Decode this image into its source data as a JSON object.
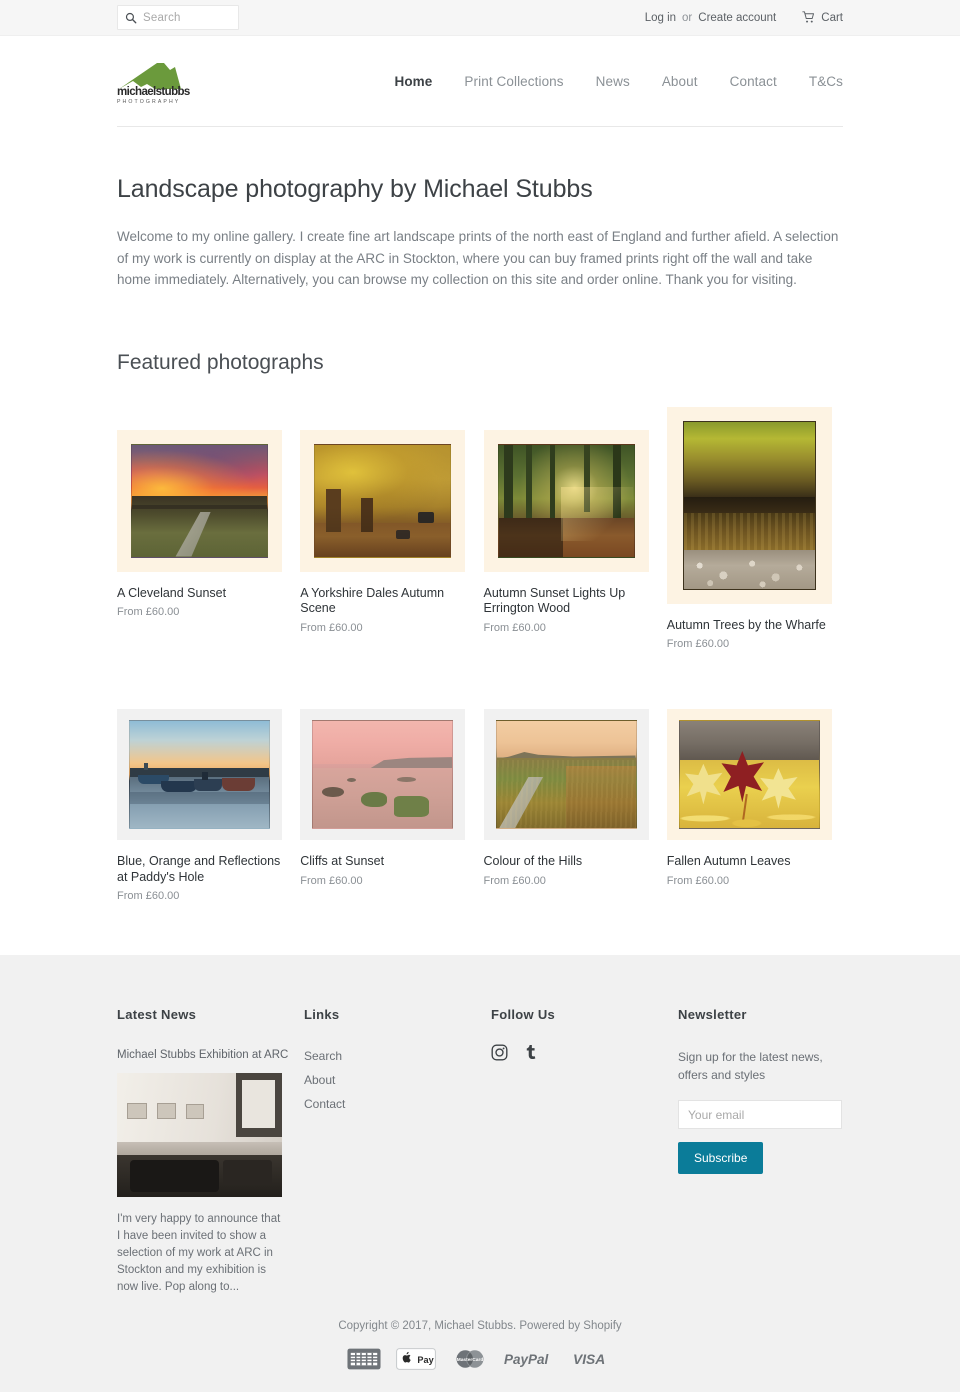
{
  "topbar": {
    "search": {
      "placeholder": "Search",
      "icon": "search-icon"
    },
    "login_label": "Log in",
    "or_label": "or",
    "create_account_label": "Create account",
    "cart_label": "Cart",
    "cart_icon": "cart-icon"
  },
  "header": {
    "logo_wordmark": "michaelstubbs",
    "logo_subtext": "PHOTOGRAPHY",
    "logo_color": "#6b9a3c",
    "nav": [
      {
        "label": "Home",
        "active": true
      },
      {
        "label": "Print Collections",
        "active": false
      },
      {
        "label": "News",
        "active": false
      },
      {
        "label": "About",
        "active": false
      },
      {
        "label": "Contact",
        "active": false
      },
      {
        "label": "T&Cs",
        "active": false
      }
    ]
  },
  "main": {
    "page_title": "Landscape photography by Michael Stubbs",
    "intro": "Welcome to my online gallery. I create fine art landscape prints of the north east of England and further afield. A selection of my work is currently on display at the ARC in Stockton, where you can buy framed prints right off the wall and take home immediately. Alternatively, you can browse my collection on this site and order online. Thank you for visiting.",
    "section_title": "Featured photographs",
    "products_row1": [
      {
        "title": "A Cleveland Sunset",
        "price": "From £60.00",
        "mat": "cream",
        "orientation": "landscape"
      },
      {
        "title": "A Yorkshire Dales Autumn Scene",
        "price": "From £60.00",
        "mat": "cream",
        "orientation": "landscape"
      },
      {
        "title": "Autumn Sunset Lights Up Errington Wood",
        "price": "From £60.00",
        "mat": "cream",
        "orientation": "landscape"
      },
      {
        "title": "Autumn Trees by the Wharfe",
        "price": "From £60.00",
        "mat": "cream",
        "orientation": "portrait"
      }
    ],
    "products_row2": [
      {
        "title": "Blue, Orange and Reflections at Paddy's Hole",
        "price": "From £60.00",
        "mat": "white",
        "orientation": "landscape"
      },
      {
        "title": "Cliffs at Sunset",
        "price": "From £60.00",
        "mat": "white",
        "orientation": "landscape"
      },
      {
        "title": "Colour of the Hills",
        "price": "From £60.00",
        "mat": "white",
        "orientation": "landscape"
      },
      {
        "title": "Fallen Autumn Leaves",
        "price": "From £60.00",
        "mat": "cream",
        "orientation": "landscape"
      }
    ]
  },
  "footer": {
    "news_heading": "Latest News",
    "news_title": "Michael Stubbs Exhibition at ARC",
    "news_excerpt": "I'm very happy to announce that I have been invited to show a selection of my work at ARC in Stockton and my exhibition is now live. Pop along to...",
    "links_heading": "Links",
    "links": [
      {
        "label": "Search"
      },
      {
        "label": "About"
      },
      {
        "label": "Contact"
      }
    ],
    "follow_heading": "Follow Us",
    "social": [
      {
        "name": "instagram-icon"
      },
      {
        "name": "tumblr-icon"
      }
    ],
    "newsletter_heading": "Newsletter",
    "newsletter_text": "Sign up for the latest news, offers and styles",
    "newsletter_placeholder": "Your email",
    "subscribe_label": "Subscribe",
    "subscribe_color": "#0b7c99",
    "copyright": "Copyright © 2017, Michael Stubbs. Powered by Shopify",
    "payment_methods": [
      {
        "name": "american-express-icon",
        "label": "AMERICAN EXPRESS"
      },
      {
        "name": "apple-pay-icon",
        "label": "Pay"
      },
      {
        "name": "mastercard-icon",
        "label": "MasterCard"
      },
      {
        "name": "paypal-icon",
        "label": "PayPal"
      },
      {
        "name": "visa-icon",
        "label": "VISA"
      }
    ]
  }
}
